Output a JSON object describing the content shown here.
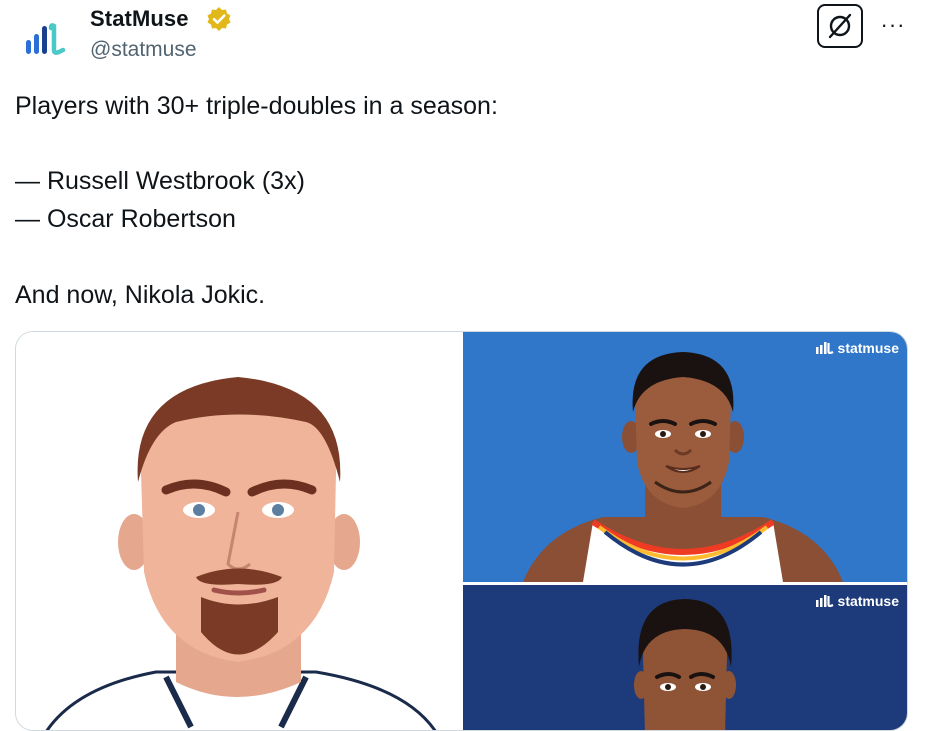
{
  "author": {
    "name": "StatMuse",
    "handle": "@statmuse",
    "verified": true,
    "avatar_icon": "statmuse-logo-icon"
  },
  "actions": {
    "grok_icon": "grok-icon",
    "more_label": "···"
  },
  "tweet": {
    "lines": [
      "Players with 30+ triple-doubles in a season:",
      "",
      "— Russell Westbrook (3x)",
      "— Oscar Robertson",
      "",
      "And now, Nikola Jokic."
    ]
  },
  "media": {
    "watermark": "statmuse",
    "colors": {
      "top_right_bg": "#3077c9",
      "bottom_right_bg": "#1d3b7a",
      "left_bg": "#ffffff",
      "verified_gold": "#e2b719"
    }
  }
}
